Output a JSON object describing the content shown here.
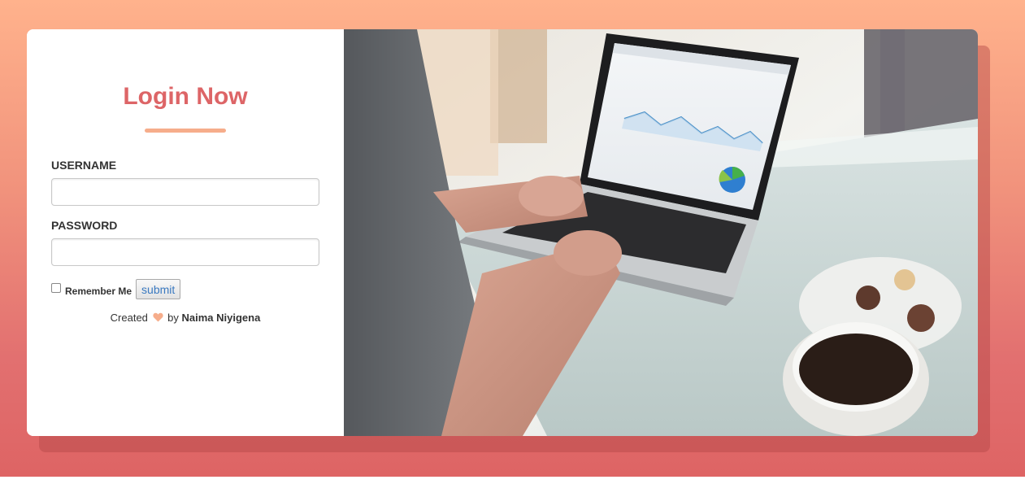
{
  "login": {
    "title": "Login Now",
    "username_label": "USERNAME",
    "username_value": "",
    "password_label": "PASSWORD",
    "password_value": "",
    "remember_label": "Remember Me",
    "submit_label": "submit",
    "credit_prefix": "Created",
    "credit_by": "by",
    "credit_author": "Naima Niyigena"
  },
  "colors": {
    "accent": "#dd6567",
    "underline": "#f6ad8b",
    "heart": "#f6ad8b",
    "gradient_top": "#ffb28c",
    "gradient_bottom": "#de6464"
  },
  "icons": {
    "heart": "heart-icon"
  }
}
